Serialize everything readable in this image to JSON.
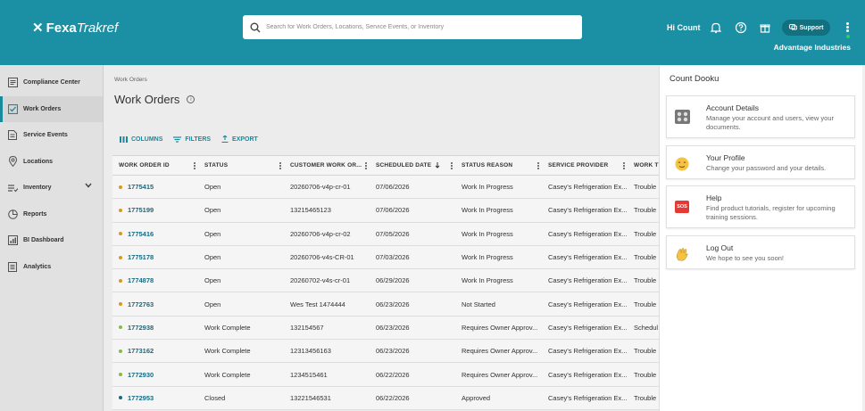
{
  "header": {
    "logo_part1": "Fexa",
    "logo_part2": "Trakref",
    "search_placeholder": "Search for Work Orders, Locations, Service Events, or Inventory",
    "greeting": "Hi Count",
    "support_label": "Support",
    "company": "Advantage Industries"
  },
  "sidebar": {
    "items": [
      {
        "label": "Compliance Center",
        "icon": "checklist-icon"
      },
      {
        "label": "Work Orders",
        "icon": "checkbox-icon"
      },
      {
        "label": "Service Events",
        "icon": "document-icon"
      },
      {
        "label": "Locations",
        "icon": "pin-icon"
      },
      {
        "label": "Inventory",
        "icon": "list-icon"
      },
      {
        "label": "Reports",
        "icon": "pie-icon"
      },
      {
        "label": "BI Dashboard",
        "icon": "dashboard-icon"
      },
      {
        "label": "Analytics",
        "icon": "analytics-icon"
      }
    ]
  },
  "main": {
    "breadcrumb": "Work Orders",
    "title": "Work Orders",
    "info_glyph": "i",
    "toolbar": {
      "columns": "COLUMNS",
      "filters": "FILTERS",
      "export": "EXPORT"
    },
    "headers": [
      "WORK ORDER ID",
      "STATUS",
      "CUSTOMER WORK OR...",
      "SCHEDULED DATE",
      "STATUS REASON",
      "SERVICE PROVIDER",
      "WORK TY"
    ],
    "rows": [
      {
        "id": "1775415",
        "status": "Open",
        "cwo": "20260706-v4p-cr-01",
        "date": "07/06/2026",
        "reason": "Work In Progress",
        "provider": "Casey's Refrigeration Ex...",
        "type": "Trouble",
        "dot": "#e0a21a"
      },
      {
        "id": "1775199",
        "status": "Open",
        "cwo": "13215465123",
        "date": "07/06/2026",
        "reason": "Work In Progress",
        "provider": "Casey's Refrigeration Ex...",
        "type": "Trouble",
        "dot": "#e0a21a"
      },
      {
        "id": "1775416",
        "status": "Open",
        "cwo": "20260706-v4p-cr-02",
        "date": "07/05/2026",
        "reason": "Work In Progress",
        "provider": "Casey's Refrigeration Ex...",
        "type": "Trouble",
        "dot": "#e0a21a"
      },
      {
        "id": "1775178",
        "status": "Open",
        "cwo": "20260706-v4s-CR-01",
        "date": "07/03/2026",
        "reason": "Work In Progress",
        "provider": "Casey's Refrigeration Ex...",
        "type": "Trouble",
        "dot": "#e0a21a"
      },
      {
        "id": "1774878",
        "status": "Open",
        "cwo": "20260702-v4s-cr-01",
        "date": "06/29/2026",
        "reason": "Work In Progress",
        "provider": "Casey's Refrigeration Ex...",
        "type": "Trouble",
        "dot": "#e0a21a"
      },
      {
        "id": "1772763",
        "status": "Open",
        "cwo": "Wes Test 1474444",
        "date": "06/23/2026",
        "reason": "Not Started",
        "provider": "Casey's Refrigeration Ex...",
        "type": "Trouble",
        "dot": "#e0a21a"
      },
      {
        "id": "1772938",
        "status": "Work Complete",
        "cwo": "132154567",
        "date": "06/23/2026",
        "reason": "Requires Owner Approv...",
        "provider": "Casey's Refrigeration Ex...",
        "type": "Schedul",
        "dot": "#8bc34a"
      },
      {
        "id": "1773162",
        "status": "Work Complete",
        "cwo": "12313456163",
        "date": "06/23/2026",
        "reason": "Requires Owner Approv...",
        "provider": "Casey's Refrigeration Ex...",
        "type": "Trouble",
        "dot": "#8bc34a"
      },
      {
        "id": "1772930",
        "status": "Work Complete",
        "cwo": "1234515461",
        "date": "06/22/2026",
        "reason": "Requires Owner Approv...",
        "provider": "Casey's Refrigeration Ex...",
        "type": "Trouble",
        "dot": "#8bc34a"
      },
      {
        "id": "1772953",
        "status": "Closed",
        "cwo": "13221546531",
        "date": "06/22/2026",
        "reason": "Approved",
        "provider": "Casey's Refrigeration Ex...",
        "type": "Trouble",
        "dot": "#1b6f86"
      }
    ]
  },
  "panel": {
    "name": "Count Dooku",
    "cards": [
      {
        "title": "Account Details",
        "desc": "Manage your account and users, view your documents.",
        "icon": "account-grid-icon"
      },
      {
        "title": "Your Profile",
        "desc": "Change your password and your details.",
        "icon": "smiley-icon"
      },
      {
        "title": "Help",
        "desc": "Find product tutorials, register for upcoming training sessions.",
        "icon": "sos-icon",
        "badge": "SOS"
      },
      {
        "title": "Log Out",
        "desc": "We hope to see you soon!",
        "icon": "wave-icon"
      }
    ]
  },
  "colors": {
    "brand": "#1b8fa3",
    "open_dot": "#e0a21a",
    "complete_dot": "#8bc34a",
    "closed_dot": "#1b6f86"
  }
}
